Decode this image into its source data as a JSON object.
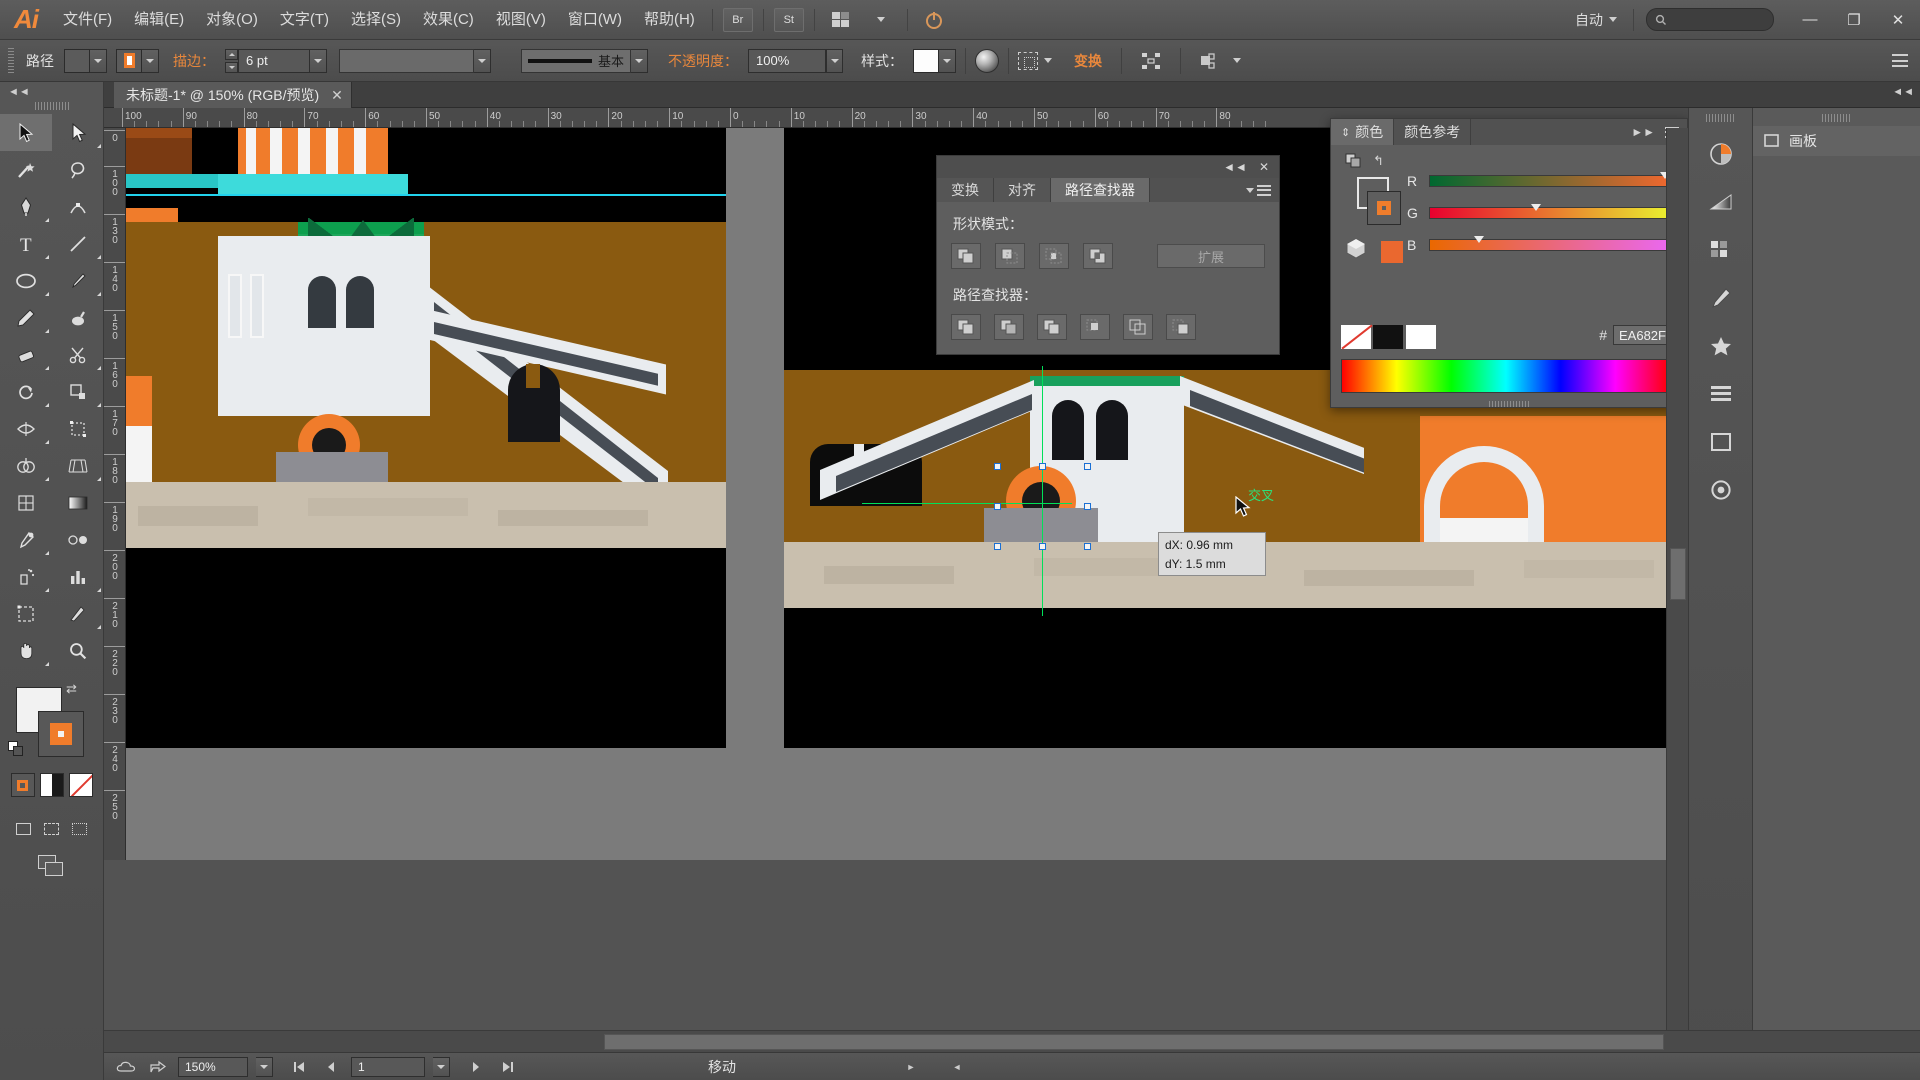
{
  "app": {
    "name": "Ai",
    "logo": "Ai"
  },
  "menubar": {
    "items": [
      {
        "label": "文件(F)",
        "name": "menu-file"
      },
      {
        "label": "编辑(E)",
        "name": "menu-edit"
      },
      {
        "label": "对象(O)",
        "name": "menu-object"
      },
      {
        "label": "文字(T)",
        "name": "menu-type"
      },
      {
        "label": "选择(S)",
        "name": "menu-select"
      },
      {
        "label": "效果(C)",
        "name": "menu-effect"
      },
      {
        "label": "视图(V)",
        "name": "menu-view"
      },
      {
        "label": "窗口(W)",
        "name": "menu-window"
      },
      {
        "label": "帮助(H)",
        "name": "menu-help"
      }
    ],
    "bridge_button": "Br",
    "stock_button": "St",
    "workspace_label": "自动",
    "search_placeholder": "",
    "window_minimize": "—",
    "window_restore": "❐",
    "window_close": "✕"
  },
  "controlbar": {
    "object_label": "路径",
    "fill_label": "",
    "stroke_label": "描边：",
    "stroke_weight": "6 pt",
    "stroke_profile": "",
    "brush_label": "基本",
    "opacity_label": "不透明度：",
    "opacity_value": "100%",
    "style_label": "样式：",
    "transform_label": "变换",
    "align_label": ""
  },
  "document_tab": {
    "title": "未标题-1* @ 150% (RGB/预览)",
    "close": "✕"
  },
  "rulers": {
    "horizontal_labels": [
      "100",
      "90",
      "80",
      "70",
      "60",
      "50",
      "40",
      "30",
      "20",
      "10",
      "0",
      "10",
      "20",
      "30",
      "40",
      "50",
      "60",
      "70",
      "80"
    ],
    "vertical_labels": [
      "0",
      "1 0 0",
      "1 3 0",
      "1 4 0",
      "1 5 0",
      "1 6 0",
      "1 7 0",
      "1 8 0",
      "1 9 0",
      "2 0 0",
      "2 1 0",
      "2 2 0",
      "2 3 0",
      "2 4 0",
      "2 5 0"
    ],
    "unit": "mm"
  },
  "pathfinder_panel": {
    "tabs": [
      {
        "label": "变换",
        "active": false,
        "name": "tab-transform"
      },
      {
        "label": "对齐",
        "active": false,
        "name": "tab-align"
      },
      {
        "label": "路径查找器",
        "active": true,
        "name": "tab-pathfinder"
      }
    ],
    "shape_modes_label": "形状模式：",
    "pathfinders_label": "路径查找器：",
    "expand_button": "扩展",
    "collapse_icon": "◄◄",
    "close_icon": "✕",
    "shape_mode_buttons": [
      {
        "name": "unite-button"
      },
      {
        "name": "minus-front-button"
      },
      {
        "name": "intersect-button"
      },
      {
        "name": "exclude-button"
      }
    ],
    "pathfinder_buttons": [
      {
        "name": "divide-button"
      },
      {
        "name": "trim-button"
      },
      {
        "name": "merge-button"
      },
      {
        "name": "crop-button"
      },
      {
        "name": "outline-button"
      },
      {
        "name": "minus-back-button"
      }
    ]
  },
  "color_panel": {
    "tabs": [
      {
        "label": "颜色",
        "active": true,
        "name": "tab-color"
      },
      {
        "label": "颜色参考",
        "active": false,
        "name": "tab-color-guide"
      }
    ],
    "collapse_icon": "►►",
    "menu_icon": "≡",
    "channels": [
      {
        "name": "R",
        "value": "234",
        "percent": 92
      },
      {
        "name": "G",
        "value": "104",
        "percent": 41
      },
      {
        "name": "B",
        "value": "47",
        "percent": 18
      }
    ],
    "hex_label": "#",
    "hex_value": "EA682F",
    "fill_color": "#EA682F",
    "none_swatch": "none",
    "black_swatch": "#000000",
    "white_swatch": "#FFFFFF"
  },
  "right_dock": {
    "buttons": [
      {
        "name": "dock-color-button",
        "icon": "color-wheel-icon"
      },
      {
        "name": "dock-gradient-button",
        "icon": "gradient-icon"
      },
      {
        "name": "dock-swatches-button",
        "icon": "swatches-grid-icon"
      },
      {
        "name": "dock-brushes-button",
        "icon": "brush-icon"
      },
      {
        "name": "dock-symbols-button",
        "icon": "symbols-icon"
      },
      {
        "name": "dock-layers-button",
        "icon": "layers-lines-icon"
      },
      {
        "name": "dock-artboards-button",
        "icon": "artboard-square-icon"
      },
      {
        "name": "dock-appearance-button",
        "icon": "appearance-circle-icon"
      }
    ],
    "panel_title": "画板"
  },
  "measure_tooltip": {
    "dx": "dX: 0.96 mm",
    "dy": "dY: 1.5 mm"
  },
  "smart_guide": {
    "label": "交叉"
  },
  "statusbar": {
    "zoom": "150%",
    "page": "1",
    "status_text": "移动",
    "prev_icon": "◄",
    "next_icon": "►"
  },
  "toolbar": {
    "tools": [
      {
        "name": "tool-selection",
        "icon": "arrow-black-icon"
      },
      {
        "name": "tool-direct-selection",
        "icon": "arrow-white-icon"
      },
      {
        "name": "tool-magic-wand",
        "icon": "magic-wand-icon"
      },
      {
        "name": "tool-lasso",
        "icon": "lasso-icon"
      },
      {
        "name": "tool-pen",
        "icon": "pen-icon"
      },
      {
        "name": "tool-add-anchor",
        "icon": "add-anchor-icon"
      },
      {
        "name": "tool-type",
        "icon": "type-t-icon"
      },
      {
        "name": "tool-line-segment",
        "icon": "line-icon"
      },
      {
        "name": "tool-ellipse",
        "icon": "ellipse-icon"
      },
      {
        "name": "tool-paintbrush",
        "icon": "paintbrush-icon"
      },
      {
        "name": "tool-pencil",
        "icon": "pencil-icon"
      },
      {
        "name": "tool-blob-brush",
        "icon": "blob-brush-icon"
      },
      {
        "name": "tool-eraser",
        "icon": "eraser-icon"
      },
      {
        "name": "tool-rotate",
        "icon": "rotate-icon"
      },
      {
        "name": "tool-scale",
        "icon": "scale-icon"
      },
      {
        "name": "tool-width",
        "icon": "width-icon"
      },
      {
        "name": "tool-free-transform",
        "icon": "free-transform-icon"
      },
      {
        "name": "tool-shape-builder",
        "icon": "shape-builder-icon"
      },
      {
        "name": "tool-perspective-grid",
        "icon": "perspective-grid-icon"
      },
      {
        "name": "tool-mesh",
        "icon": "mesh-icon"
      },
      {
        "name": "tool-gradient",
        "icon": "gradient-bar-icon"
      },
      {
        "name": "tool-eyedropper",
        "icon": "eyedropper-icon"
      },
      {
        "name": "tool-blend",
        "icon": "blend-icon"
      },
      {
        "name": "tool-symbol-sprayer",
        "icon": "symbol-sprayer-icon"
      },
      {
        "name": "tool-column-graph",
        "icon": "column-graph-icon"
      },
      {
        "name": "tool-artboard",
        "icon": "artboard-tool-icon"
      },
      {
        "name": "tool-slice",
        "icon": "slice-knife-icon"
      },
      {
        "name": "tool-hand",
        "icon": "hand-icon"
      },
      {
        "name": "tool-zoom",
        "icon": "zoom-magnifier-icon"
      }
    ],
    "fill_color": "#F2F2F2",
    "stroke_color": "#F07C2B"
  },
  "artwork": {
    "description": "Pixel-art style illustration of an orange and white building with staircase, arches and a green roof, duplicated across two artboards",
    "colors": {
      "black": "#000000",
      "orange": "#F07C2B",
      "brown": "#8a5a10",
      "green": "#1da65a",
      "dark_green": "#0d5a33",
      "white": "#e9ecef",
      "gray": "#3a3f46",
      "cyan": "#22d3ee",
      "sand": "#c9bfae"
    }
  }
}
